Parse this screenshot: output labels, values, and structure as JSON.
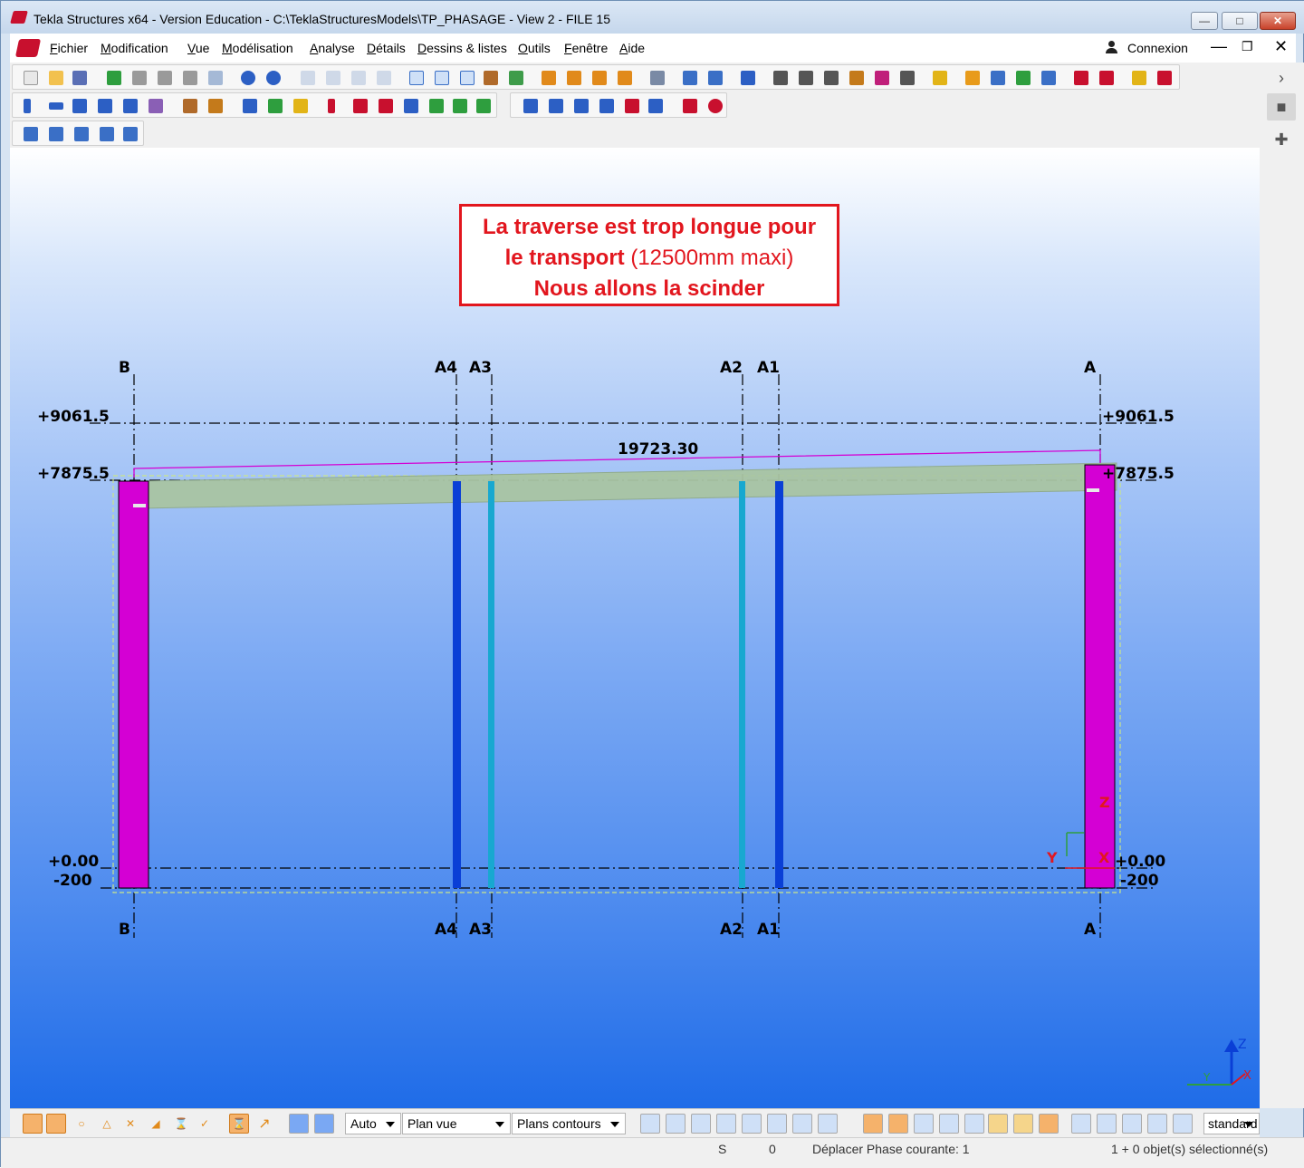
{
  "window": {
    "title": "Tekla Structures x64 - Version Education - C:\\TeklaStructuresModels\\TP_PHASAGE  - View 2 - FILE 15"
  },
  "menu": {
    "items": [
      "Fichier",
      "Modification",
      "Vue",
      "Modélisation",
      "Analyse",
      "Détails",
      "Dessins & listes",
      "Outils",
      "Fenêtre",
      "Aide"
    ],
    "login": "Connexion"
  },
  "callout": {
    "line1": "La traverse est trop longue pour",
    "line2_bold": "le transport",
    "line2_normal": " (12500mm maxi)",
    "line3": "Nous allons la scinder"
  },
  "drawing": {
    "grid_labels": {
      "b": "B",
      "a4": "A4",
      "a3": "A3",
      "a2": "A2",
      "a1": "A1",
      "a": "A"
    },
    "levels": {
      "top": "+9061.5",
      "beam": "+7875.5",
      "zero": "+0.00",
      "base": "-200"
    },
    "dimension": "19723.30",
    "axes": {
      "y": "Y",
      "x": "X",
      "z": "Z"
    },
    "colors": {
      "column": "#d400d4",
      "beam": "#a9c5a3",
      "cut_dark": "#0a3fd6",
      "cut_light": "#18a8d0",
      "callout": "#e2161e"
    }
  },
  "bottombar": {
    "select_auto": "Auto",
    "select_plan": "Plan vue",
    "select_contours": "Plans contours",
    "standard": "standard"
  },
  "status": {
    "s_label": "S",
    "s_value": "0",
    "message": "Déplacer Phase courante: 1",
    "selection": "1 + 0 objet(s) sélectionné(s)"
  }
}
